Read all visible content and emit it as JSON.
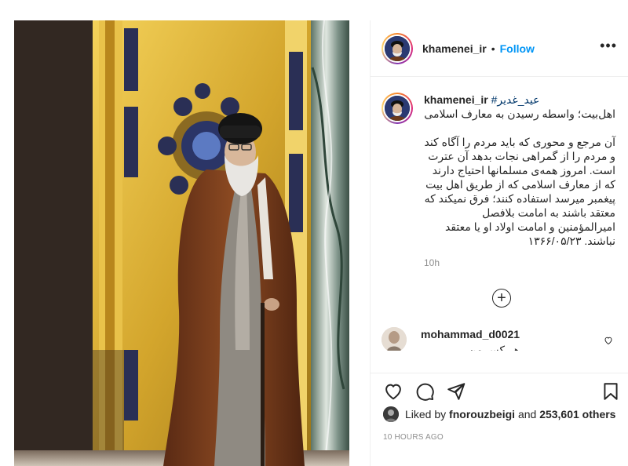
{
  "post": {
    "username": "khamenei_ir",
    "separator": "•",
    "follow_label": "Follow",
    "more_label": "•••"
  },
  "caption": {
    "username": "khamenei_ir",
    "hashtag": "#عید_غدیر",
    "text": "اهل‌بیت؛ واسطه رسیدن به معارف اسلامی\n\nآن مرجع و محوری که باید مردم را آگاه کند و مردم را از گمراهی نجات بدهد آن عترت است. امروز همه‌ی مسلمانها احتیاج دارند که از معارف اسلامی که از طریق اهل بیت پیغمبر میرسد استفاده کنند؛ فرق نمیکند که معتقد باشند به امامت بلافصل امیرالمؤمنین و امامت اولاد او یا معتقد نباشند. ۱۳۶۶/۰۵/۲۳",
    "time": "10h",
    "load_more_symbol": "+"
  },
  "comment": {
    "username": "mohammad_d0021",
    "text": "هر کس من ..."
  },
  "actions": {
    "like_icon": "heart-icon",
    "comment_icon": "comment-icon",
    "share_icon": "share-icon",
    "save_icon": "bookmark-icon"
  },
  "likes": {
    "prefix": "Liked by",
    "user": "fnorouzbeigi",
    "and": "and",
    "count": "253,601 others"
  },
  "timestamp": "10 HOURS AGO"
}
